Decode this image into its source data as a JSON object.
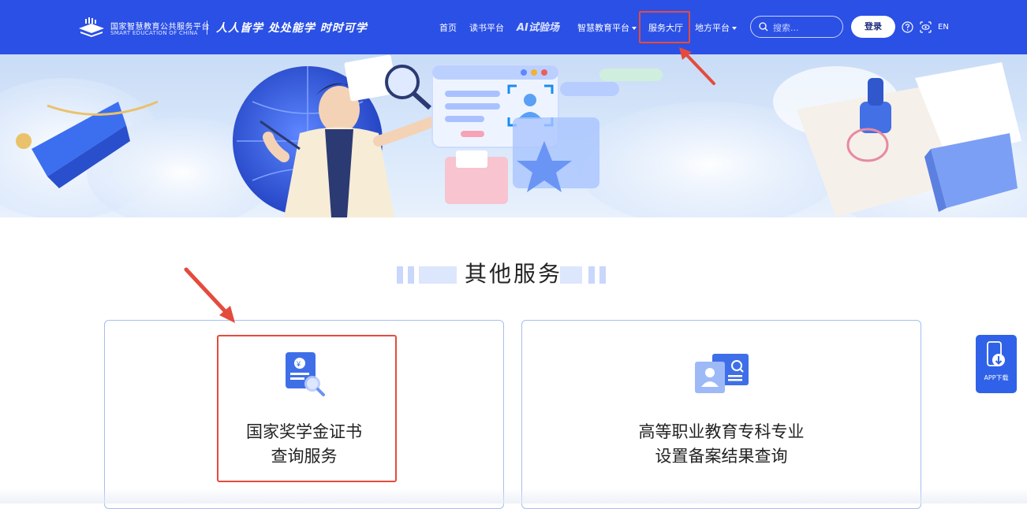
{
  "header": {
    "logo_cn": "国家智慧教育公共服务平台",
    "logo_en": "SMART EDUCATION OF CHINA",
    "slogan": "人人皆学 处处能学 时时可学",
    "nav": [
      {
        "label": "首页"
      },
      {
        "label": "读书平台"
      },
      {
        "label": "AI试验场"
      },
      {
        "label": "智慧教育平台",
        "dropdown": true
      },
      {
        "label": "服务大厅",
        "highlighted": true
      },
      {
        "label": "地方平台",
        "dropdown": true
      }
    ],
    "search_placeholder": "搜索...",
    "login_label": "登录",
    "lang_label": "EN"
  },
  "section": {
    "title": "其他服务",
    "cards": [
      {
        "line1": "国家奖学金证书",
        "line2": "查询服务",
        "icon": "certificate-search-icon",
        "highlighted": true
      },
      {
        "line1": "高等职业教育专科专业",
        "line2": "设置备案结果查询",
        "icon": "profile-search-icon"
      }
    ]
  },
  "sidebar": {
    "app_download_label": "APP下载"
  },
  "colors": {
    "header_bg": "#2b50e6",
    "highlight_border": "#e54b3c",
    "card_border": "#a6bef0",
    "app_button_bg": "#2f62e8"
  }
}
